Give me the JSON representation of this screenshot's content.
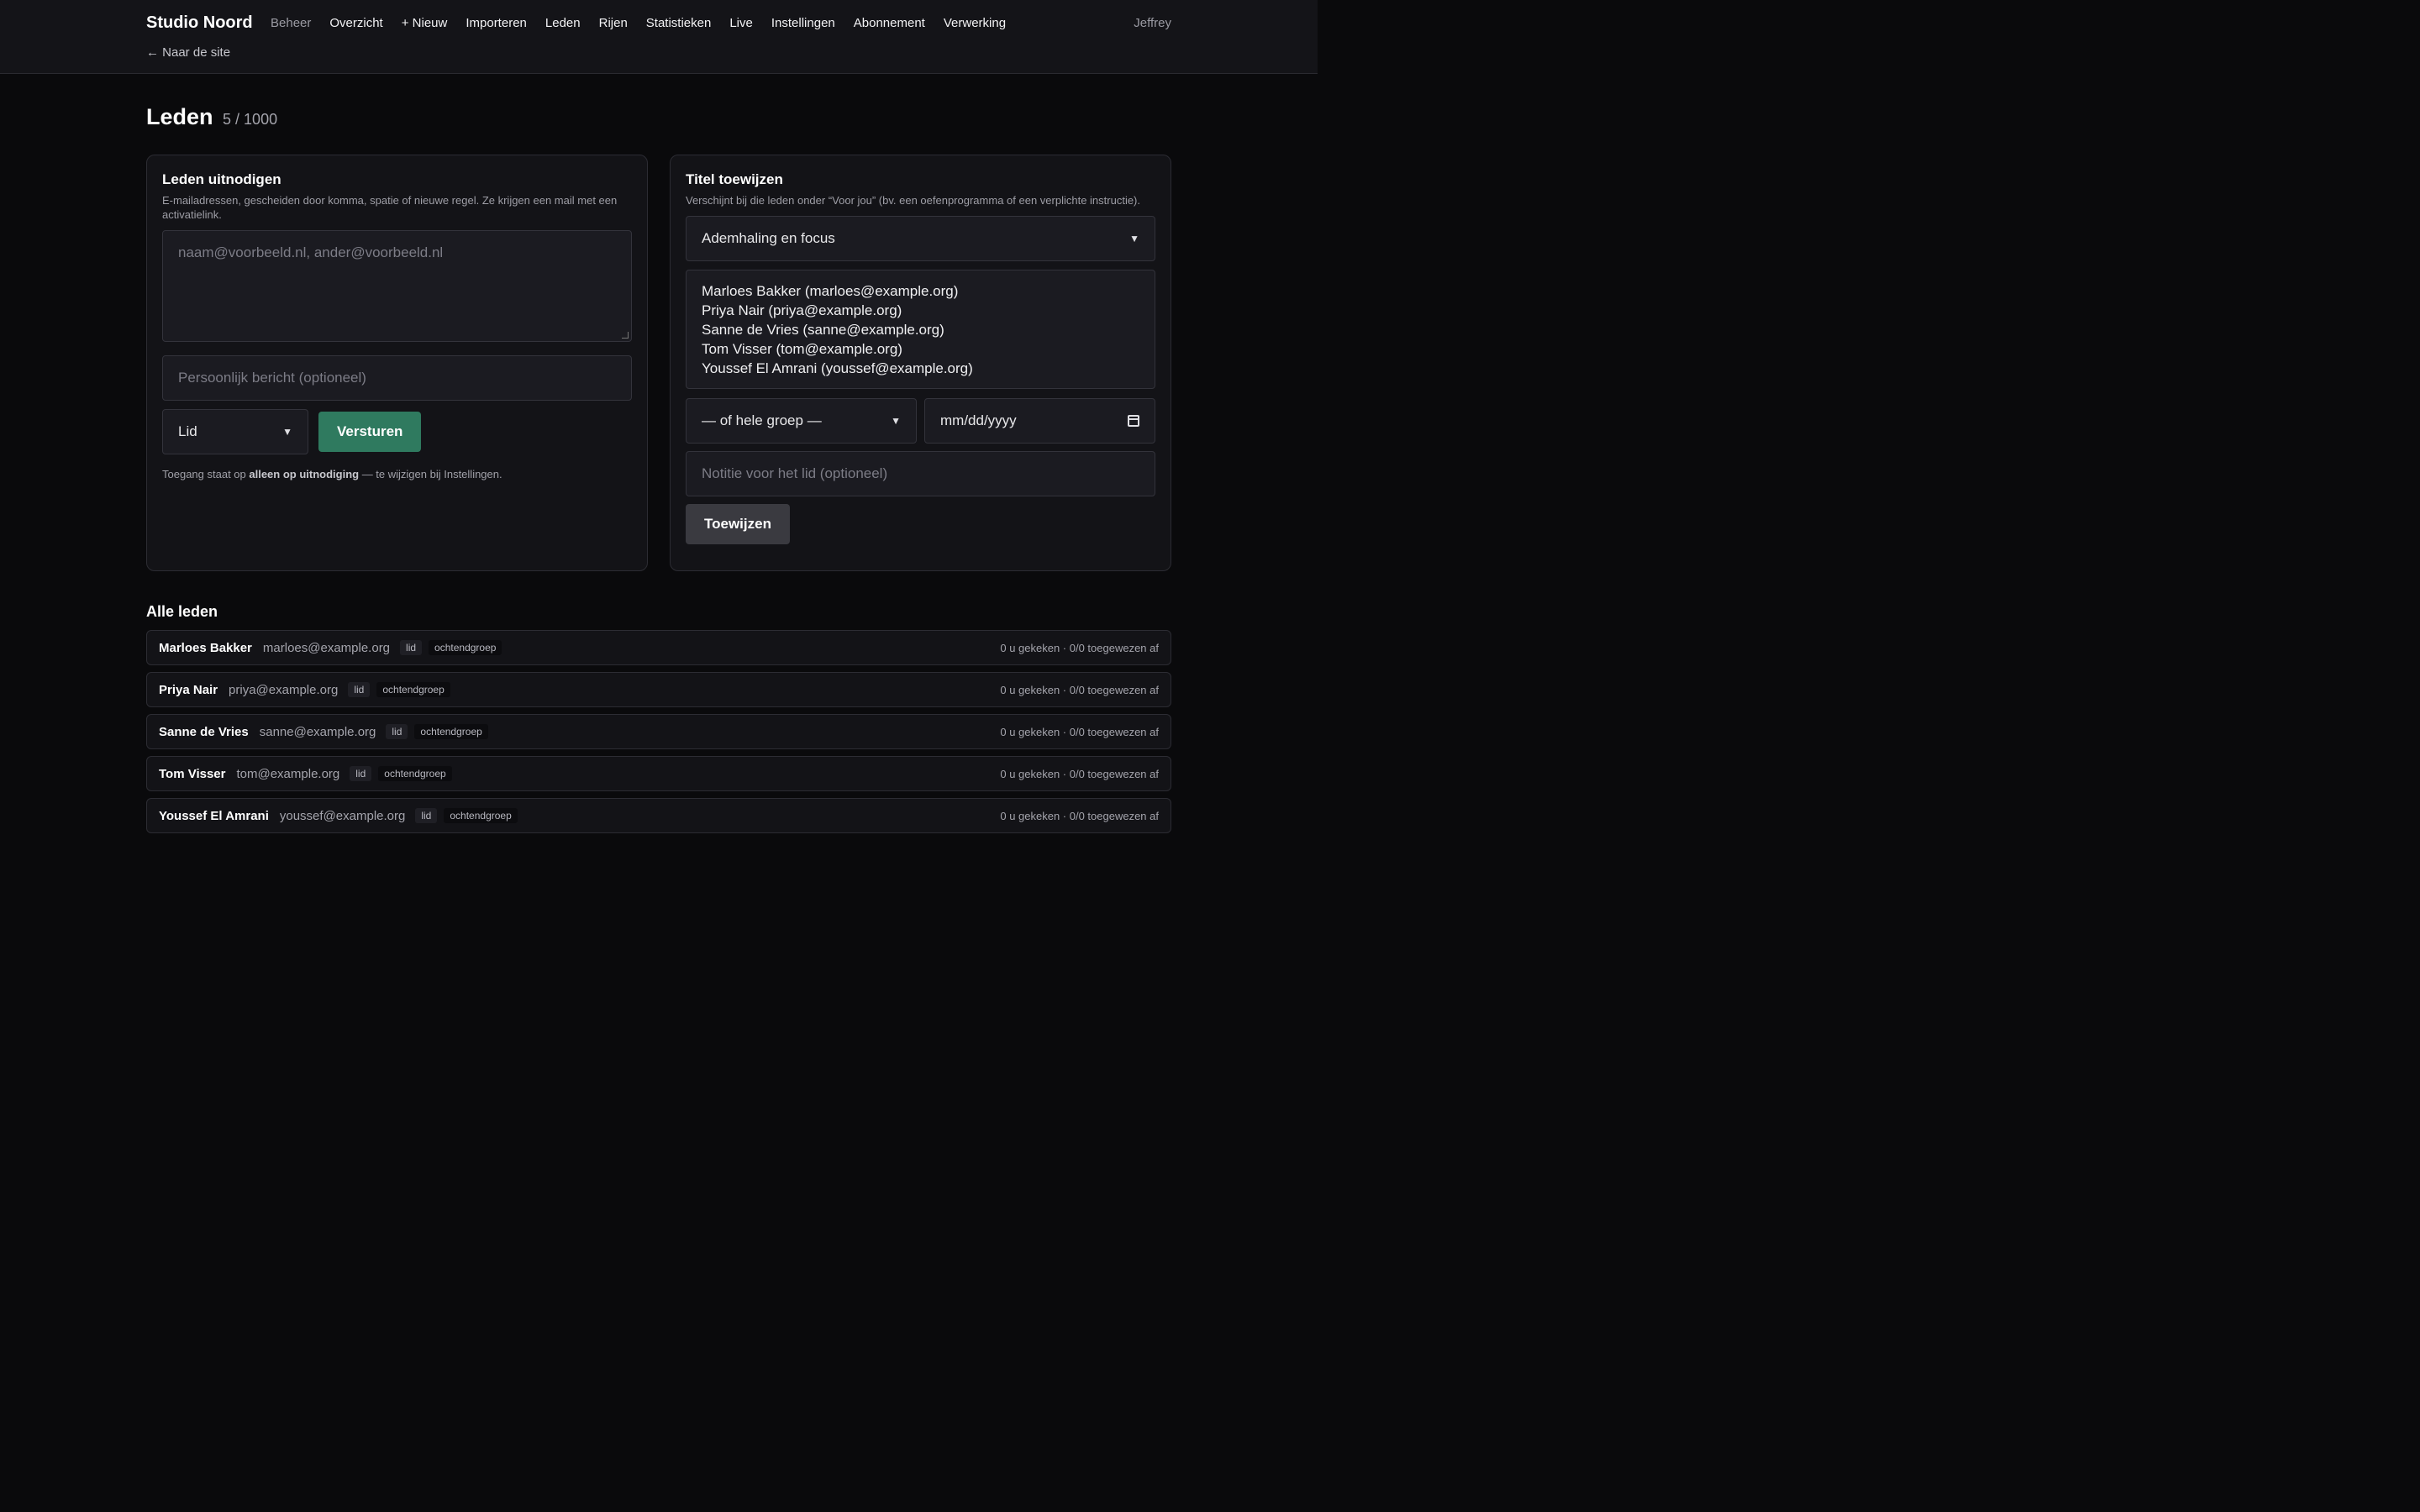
{
  "header": {
    "brand": "Studio Noord",
    "nav": [
      "Beheer",
      "Overzicht",
      "+ Nieuw",
      "Importeren",
      "Leden",
      "Rijen",
      "Statistieken",
      "Live",
      "Instellingen",
      "Abonnement",
      "Verwerking"
    ],
    "user": "Jeffrey",
    "back_link": "← Naar de site"
  },
  "page": {
    "title": "Leden",
    "count": "5 / 1000"
  },
  "invite": {
    "title": "Leden uitnodigen",
    "description": "E-mailadressen, gescheiden door komma, spatie of nieuwe regel. Ze krijgen een mail met een activatielink.",
    "emails_placeholder": "naam@voorbeeld.nl, ander@voorbeeld.nl",
    "message_placeholder": "Persoonlijk bericht (optioneel)",
    "role_value": "Lid",
    "send_label": "Versturen",
    "hint_prefix": "Toegang staat op ",
    "hint_bold": "alleen op uitnodiging",
    "hint_suffix": " — te wijzigen bij Instellingen."
  },
  "assign": {
    "title": "Titel toewijzen",
    "description": "Verschijnt bij die leden onder “Voor jou” (bv. een oefenprogramma of een verplichte instructie).",
    "title_value": "Ademhaling en focus",
    "members": [
      "Marloes Bakker (marloes@example.org)",
      "Priya Nair (priya@example.org)",
      "Sanne de Vries (sanne@example.org)",
      "Tom Visser (tom@example.org)",
      "Youssef El Amrani (youssef@example.org)"
    ],
    "group_value": "— of hele groep —",
    "date_placeholder": "mm/dd/yyyy",
    "note_placeholder": "Notitie voor het lid (optioneel)",
    "assign_label": "Toewijzen"
  },
  "all_members": {
    "title": "Alle leden",
    "rows": [
      {
        "name": "Marloes Bakker",
        "email": "marloes@example.org",
        "role": "lid",
        "group": "ochtendgroep",
        "stats": "0 u gekeken · 0/0 toegewezen af"
      },
      {
        "name": "Priya Nair",
        "email": "priya@example.org",
        "role": "lid",
        "group": "ochtendgroep",
        "stats": "0 u gekeken · 0/0 toegewezen af"
      },
      {
        "name": "Sanne de Vries",
        "email": "sanne@example.org",
        "role": "lid",
        "group": "ochtendgroep",
        "stats": "0 u gekeken · 0/0 toegewezen af"
      },
      {
        "name": "Tom Visser",
        "email": "tom@example.org",
        "role": "lid",
        "group": "ochtendgroep",
        "stats": "0 u gekeken · 0/0 toegewezen af"
      },
      {
        "name": "Youssef El Amrani",
        "email": "youssef@example.org",
        "role": "lid",
        "group": "ochtendgroep",
        "stats": "0 u gekeken · 0/0 toegewezen af"
      }
    ]
  }
}
